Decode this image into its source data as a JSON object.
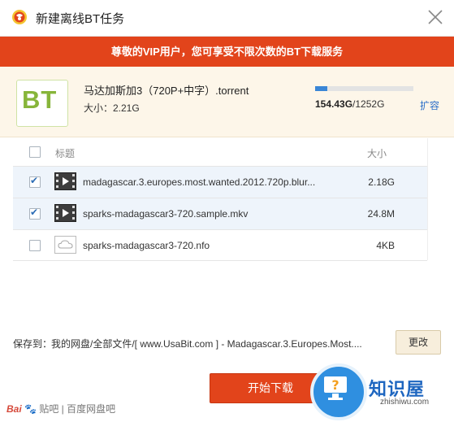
{
  "window": {
    "title": "新建离线BT任务",
    "logo_icon": "baidu-netdisk-logo-icon",
    "close_icon": "close-icon"
  },
  "banner": {
    "text": "尊敬的VIP用户，您可享受不限次数的BT下载服务",
    "color": "#e2441b"
  },
  "torrent": {
    "icon_text": "BT",
    "name": "马达加斯加3（720P+中字）.torrent",
    "size": "大小：2.21G"
  },
  "quota": {
    "used": "154.43G",
    "total": "/1252G",
    "fraction": 0.123,
    "expand_label": "扩容"
  },
  "list": {
    "header": {
      "title": "标题",
      "size": "大小"
    },
    "files": [
      {
        "name": "madagascar.3.europes.most.wanted.2012.720p.blur...",
        "size": "2.18G",
        "checked": true,
        "icon": "video-file-icon"
      },
      {
        "name": "sparks-madagascar3-720.sample.mkv",
        "size": "24.8M",
        "checked": true,
        "icon": "video-file-icon"
      },
      {
        "name": "sparks-madagascar3-720.nfo",
        "size": "4KB",
        "checked": false,
        "icon": "cloud-file-icon"
      }
    ]
  },
  "save": {
    "label": "保存到：",
    "path": "我的网盘/全部文件/[ www.UsaBit.com ] - Madagascar.3.Europes.Most....",
    "change_label": "更改"
  },
  "start_button": "开始下载",
  "watermarks": {
    "left_brand": "Bai",
    "left_text": "贴吧 | 百度网盘吧",
    "right_title": "知识屋",
    "right_sub": "zhishiwu.com"
  }
}
